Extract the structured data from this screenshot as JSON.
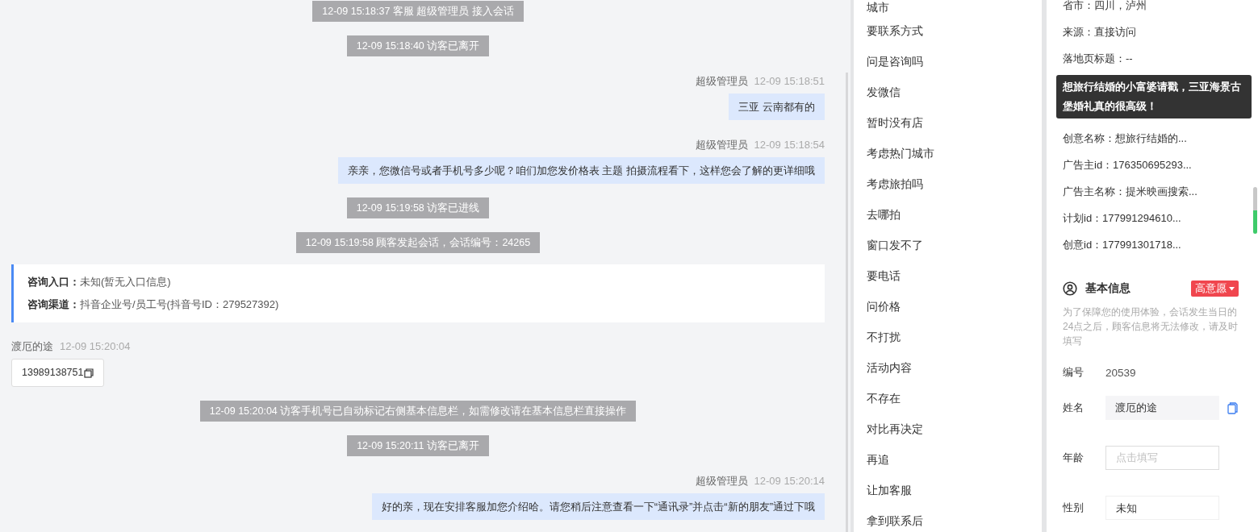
{
  "chat": {
    "messages": [
      {
        "kind": "system",
        "text": "12-09 15:18:37 客服 超级管理员 接入会话"
      },
      {
        "kind": "system",
        "text": "12-09 15:18:40 访客已离开"
      },
      {
        "kind": "agent",
        "sender": "超级管理员",
        "time": "12-09 15:18:51",
        "text": "三亚 云南都有的"
      },
      {
        "kind": "agent",
        "sender": "超级管理员",
        "time": "12-09 15:18:54",
        "text": "亲亲，您微信号或者手机号多少呢？咱们加您发价格表 主题 拍摄流程看下，这样您会了解的更详细哦"
      },
      {
        "kind": "system",
        "text": "12-09 15:19:58 访客已进线"
      },
      {
        "kind": "system",
        "text": "12-09 15:19:58 顾客发起会话，会话编号：24265"
      },
      {
        "kind": "info",
        "rows": [
          {
            "label": "咨询入口：",
            "value": "未知(暂无入口信息)"
          },
          {
            "label": "咨询渠道：",
            "value": "抖音企业号/员工号(抖音号ID：279527392)"
          }
        ]
      },
      {
        "kind": "visitor",
        "sender": "渡厄的途",
        "time": "12-09 15:20:04",
        "text": "13989138751"
      },
      {
        "kind": "system",
        "text": "12-09 15:20:04 访客手机号已自动标记右侧基本信息栏，如需修改请在基本信息栏直接操作"
      },
      {
        "kind": "system",
        "text": "12-09 15:20:11 访客已离开"
      },
      {
        "kind": "agent",
        "sender": "超级管理员",
        "time": "12-09 15:20:14",
        "text": "好的亲，现在安排客服加您介绍哈。请您稍后注意查看一下“通讯录”并点击“新的朋友”通过下哦"
      },
      {
        "kind": "blank"
      }
    ]
  },
  "quick_replies": [
    "城市",
    "要联系方式",
    "问是咨询吗",
    "发微信",
    "暂时没有店",
    "考虑热门城市",
    "考虑旅拍吗",
    "去哪拍",
    "窗口发不了",
    "要电话",
    "问价格",
    "不打扰",
    "活动内容",
    "不存在",
    "对比再决定",
    "再追",
    "让加客服",
    "拿到联系后"
  ],
  "visitor_info": {
    "rows": [
      "省市：四川，泸州",
      "来源：直接访问",
      "落地页标题：--",
      null,
      null,
      "创意名称：想旅行结婚的...",
      "广告主id：176350695293...",
      "广告主名称：提米映画搜索...",
      "计划id：177991294610...",
      "创意id：177991301718..."
    ],
    "tooltip": "想旅行结婚的小富婆请戳，三亚海景古堡婚礼真的很高级！"
  },
  "basic_info": {
    "title": "基本信息",
    "intent_tag": "高意愿",
    "note": "为了保障您的使用体验，会话发生当日的24点之后，顾客信息将无法修改，请及时填写",
    "fields": [
      {
        "kind": "text",
        "label": "编号",
        "value": "20539"
      },
      {
        "kind": "readonly",
        "label": "姓名",
        "value": "渡厄的途"
      },
      {
        "kind": "input",
        "label": "年龄",
        "placeholder": "点击填写"
      },
      {
        "kind": "select",
        "label": "性别",
        "value": "未知"
      }
    ]
  }
}
